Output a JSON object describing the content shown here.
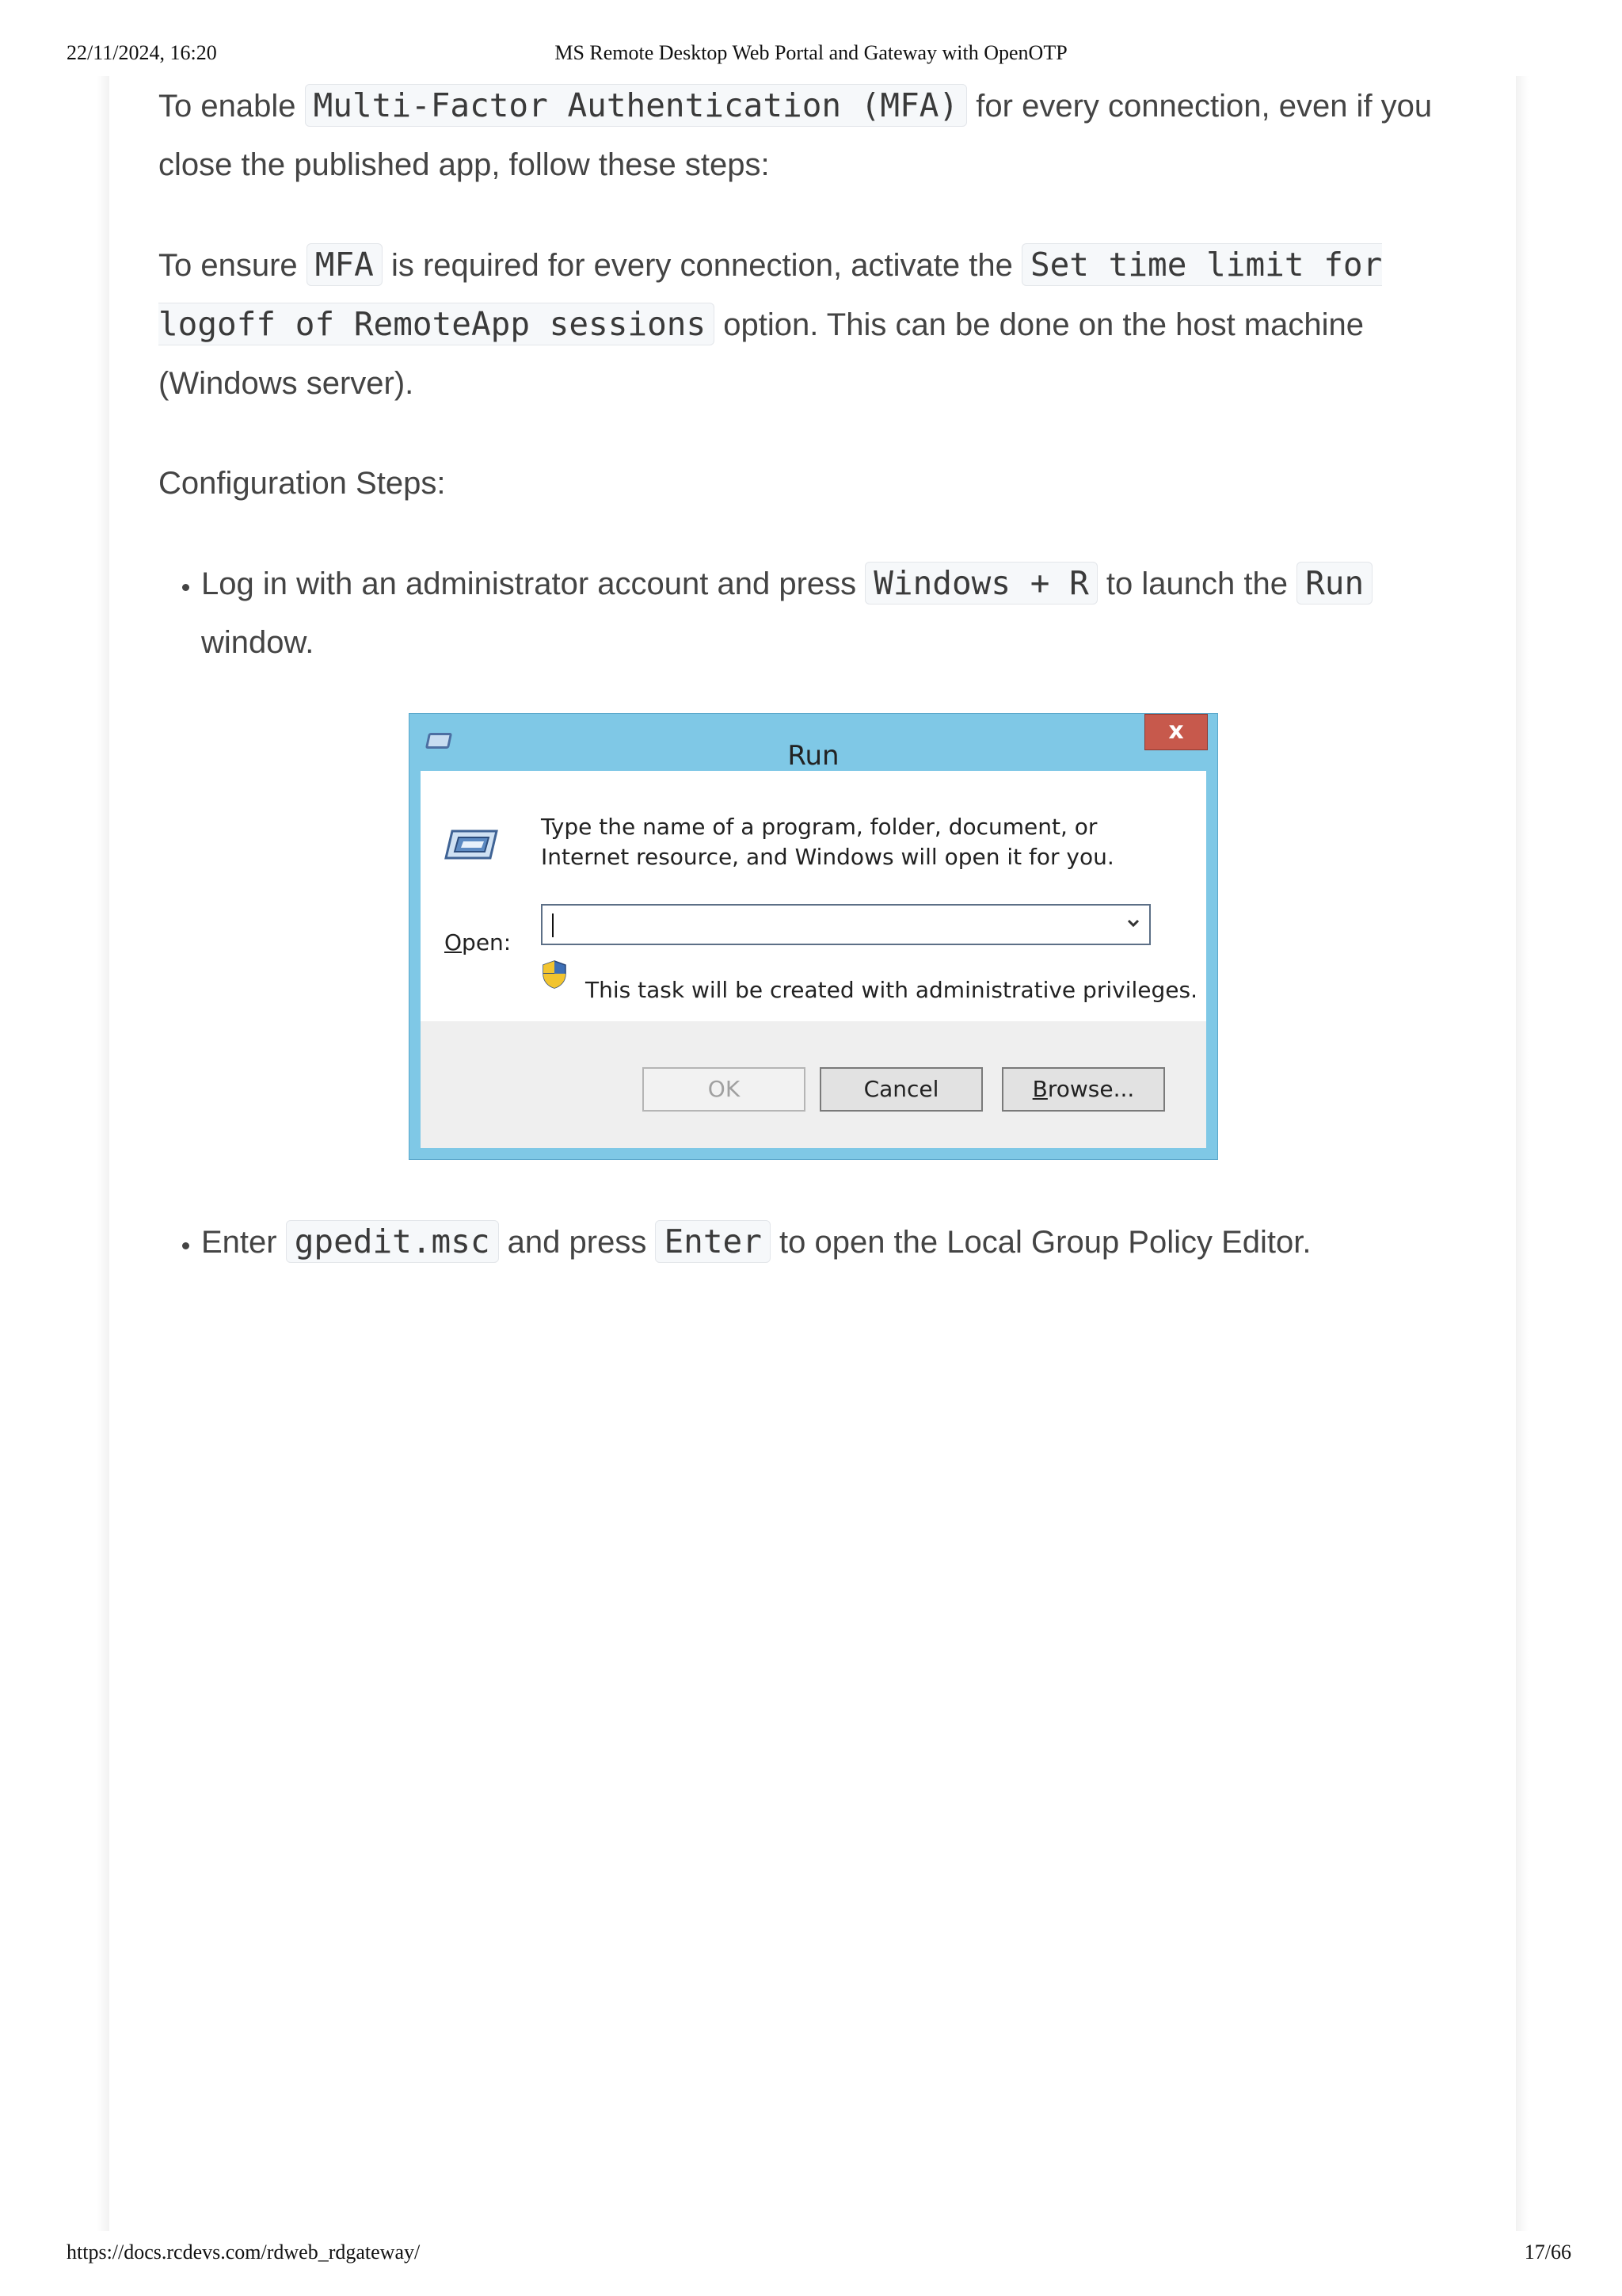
{
  "print_header": {
    "datetime": "22/11/2024, 16:20",
    "title": "MS Remote Desktop Web Portal and Gateway with OpenOTP"
  },
  "print_footer": {
    "url": "https://docs.rcdevs.com/rdweb_rdgateway/",
    "page": "17/66"
  },
  "intro": {
    "p1_a": "To enable ",
    "p1_code": "Multi-Factor Authentication (MFA)",
    "p1_b": " for every connection, even if you close the published app, follow these steps:",
    "p2_a": "To ensure ",
    "p2_code1": "MFA",
    "p2_b": " is required for every connection, activate the ",
    "p2_code2": "Set time limit for logoff of RemoteApp sessions",
    "p2_c": " option. This can be done on the host machine (Windows server).",
    "p3": "Configuration Steps:"
  },
  "steps": [
    {
      "a": "Log in with an administrator account and press ",
      "code1": "Windows + R",
      "b": " to launch the ",
      "code2": "Run",
      "c": " window."
    },
    {
      "a": "Enter ",
      "code1": "gpedit.msc",
      "b": " and press ",
      "code2": "Enter",
      "c": " to open the Local Group Policy Editor."
    }
  ],
  "run_dialog": {
    "title": "Run",
    "close_glyph": "x",
    "description": "Type the name of a program, folder, document, or Internet resource, and Windows will open it for you.",
    "open_label_underlined": "O",
    "open_label_rest": "pen:",
    "open_value": "",
    "admin_note": "This task will be created with administrative privileges.",
    "ok_label": "OK",
    "cancel_label": "Cancel",
    "browse_label_underlined": "B",
    "browse_label_rest": "rowse...",
    "colors": {
      "frame": "#7fc8e6",
      "close_button": "#c7594c"
    },
    "icons": [
      "run-app-icon",
      "close-icon",
      "run-program-icon",
      "chevron-down-icon",
      "uac-shield-icon"
    ]
  }
}
